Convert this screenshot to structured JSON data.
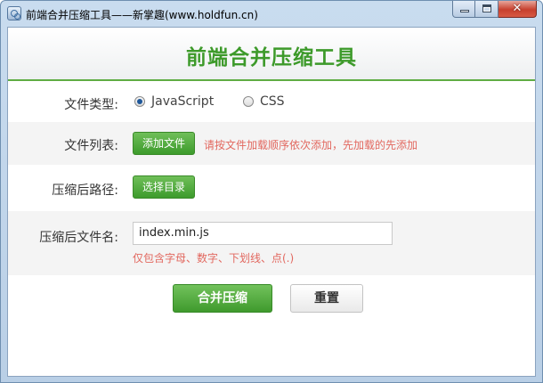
{
  "window": {
    "title": "前端合并压缩工具——新掌趣(www.holdfun.cn)",
    "minimize_icon": "minimize-icon",
    "maximize_icon": "maximize-icon",
    "close_glyph": "✕"
  },
  "header": {
    "title": "前端合并压缩工具"
  },
  "form": {
    "file_type": {
      "label": "文件类型:",
      "options": [
        {
          "label": "JavaScript",
          "checked": true
        },
        {
          "label": "CSS",
          "checked": false
        }
      ]
    },
    "file_list": {
      "label": "文件列表:",
      "button": "添加文件",
      "hint": "请按文件加载顺序依次添加，先加载的先添加"
    },
    "output_path": {
      "label": "压缩后路径:",
      "button": "选择目录"
    },
    "output_name": {
      "label": "压缩后文件名:",
      "value": "index.min.js",
      "hint": "仅包含字母、数字、下划线、点(.)"
    }
  },
  "actions": {
    "submit": "合并压缩",
    "reset": "重置"
  },
  "colors": {
    "accent_green": "#3d9a2a",
    "hint_red": "#e2685f",
    "radio_checked": "#1e5799"
  }
}
